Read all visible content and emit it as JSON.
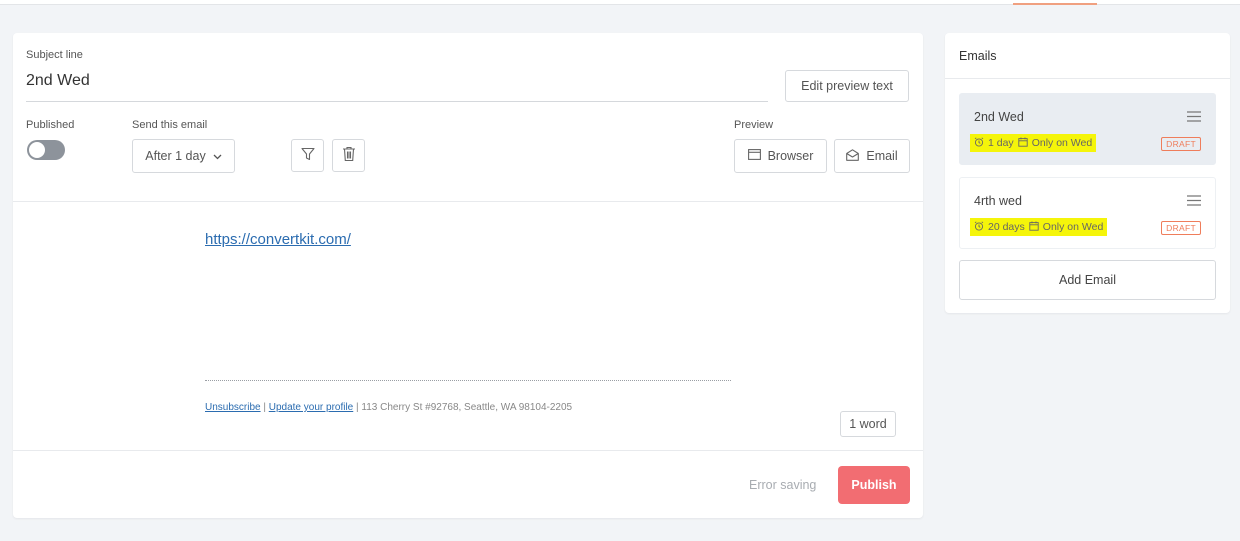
{
  "editor": {
    "subject_label": "Subject line",
    "subject_value": "2nd Wed",
    "edit_preview_label": "Edit preview text",
    "published_label": "Published",
    "published_on": false,
    "send_label": "Send this email",
    "send_value": "After 1 day",
    "preview_label": "Preview",
    "browser_label": "Browser",
    "email_label": "Email",
    "body_link": "https://convertkit.com/",
    "footer": {
      "unsubscribe": "Unsubscribe",
      "separator1": " | ",
      "update_profile": "Update your profile",
      "address": " | 113 Cherry St #92768, Seattle, WA 98104-2205"
    },
    "word_count": "1 word",
    "error_text": "Error saving",
    "publish_label": "Publish"
  },
  "sidebar": {
    "title": "Emails",
    "emails": [
      {
        "name": "2nd Wed",
        "delay": "1 day",
        "days": "Only on Wed",
        "status": "DRAFT",
        "selected": true
      },
      {
        "name": "4rth wed",
        "delay": "20 days",
        "days": "Only on Wed",
        "status": "DRAFT",
        "selected": false
      }
    ],
    "add_label": "Add Email"
  },
  "icons": {
    "filter": "filter-icon",
    "trash": "trash-icon",
    "browser": "browser-window-icon",
    "email": "envelope-open-icon",
    "chevron": "chevron-down-icon",
    "menu": "hamburger-menu-icon",
    "clock": "alarm-clock-icon",
    "calendar": "calendar-icon"
  },
  "colors": {
    "publish": "#f26d72",
    "draft": "#ef7d5b",
    "highlight": "#f5f50a",
    "link": "#2b6cb0"
  }
}
